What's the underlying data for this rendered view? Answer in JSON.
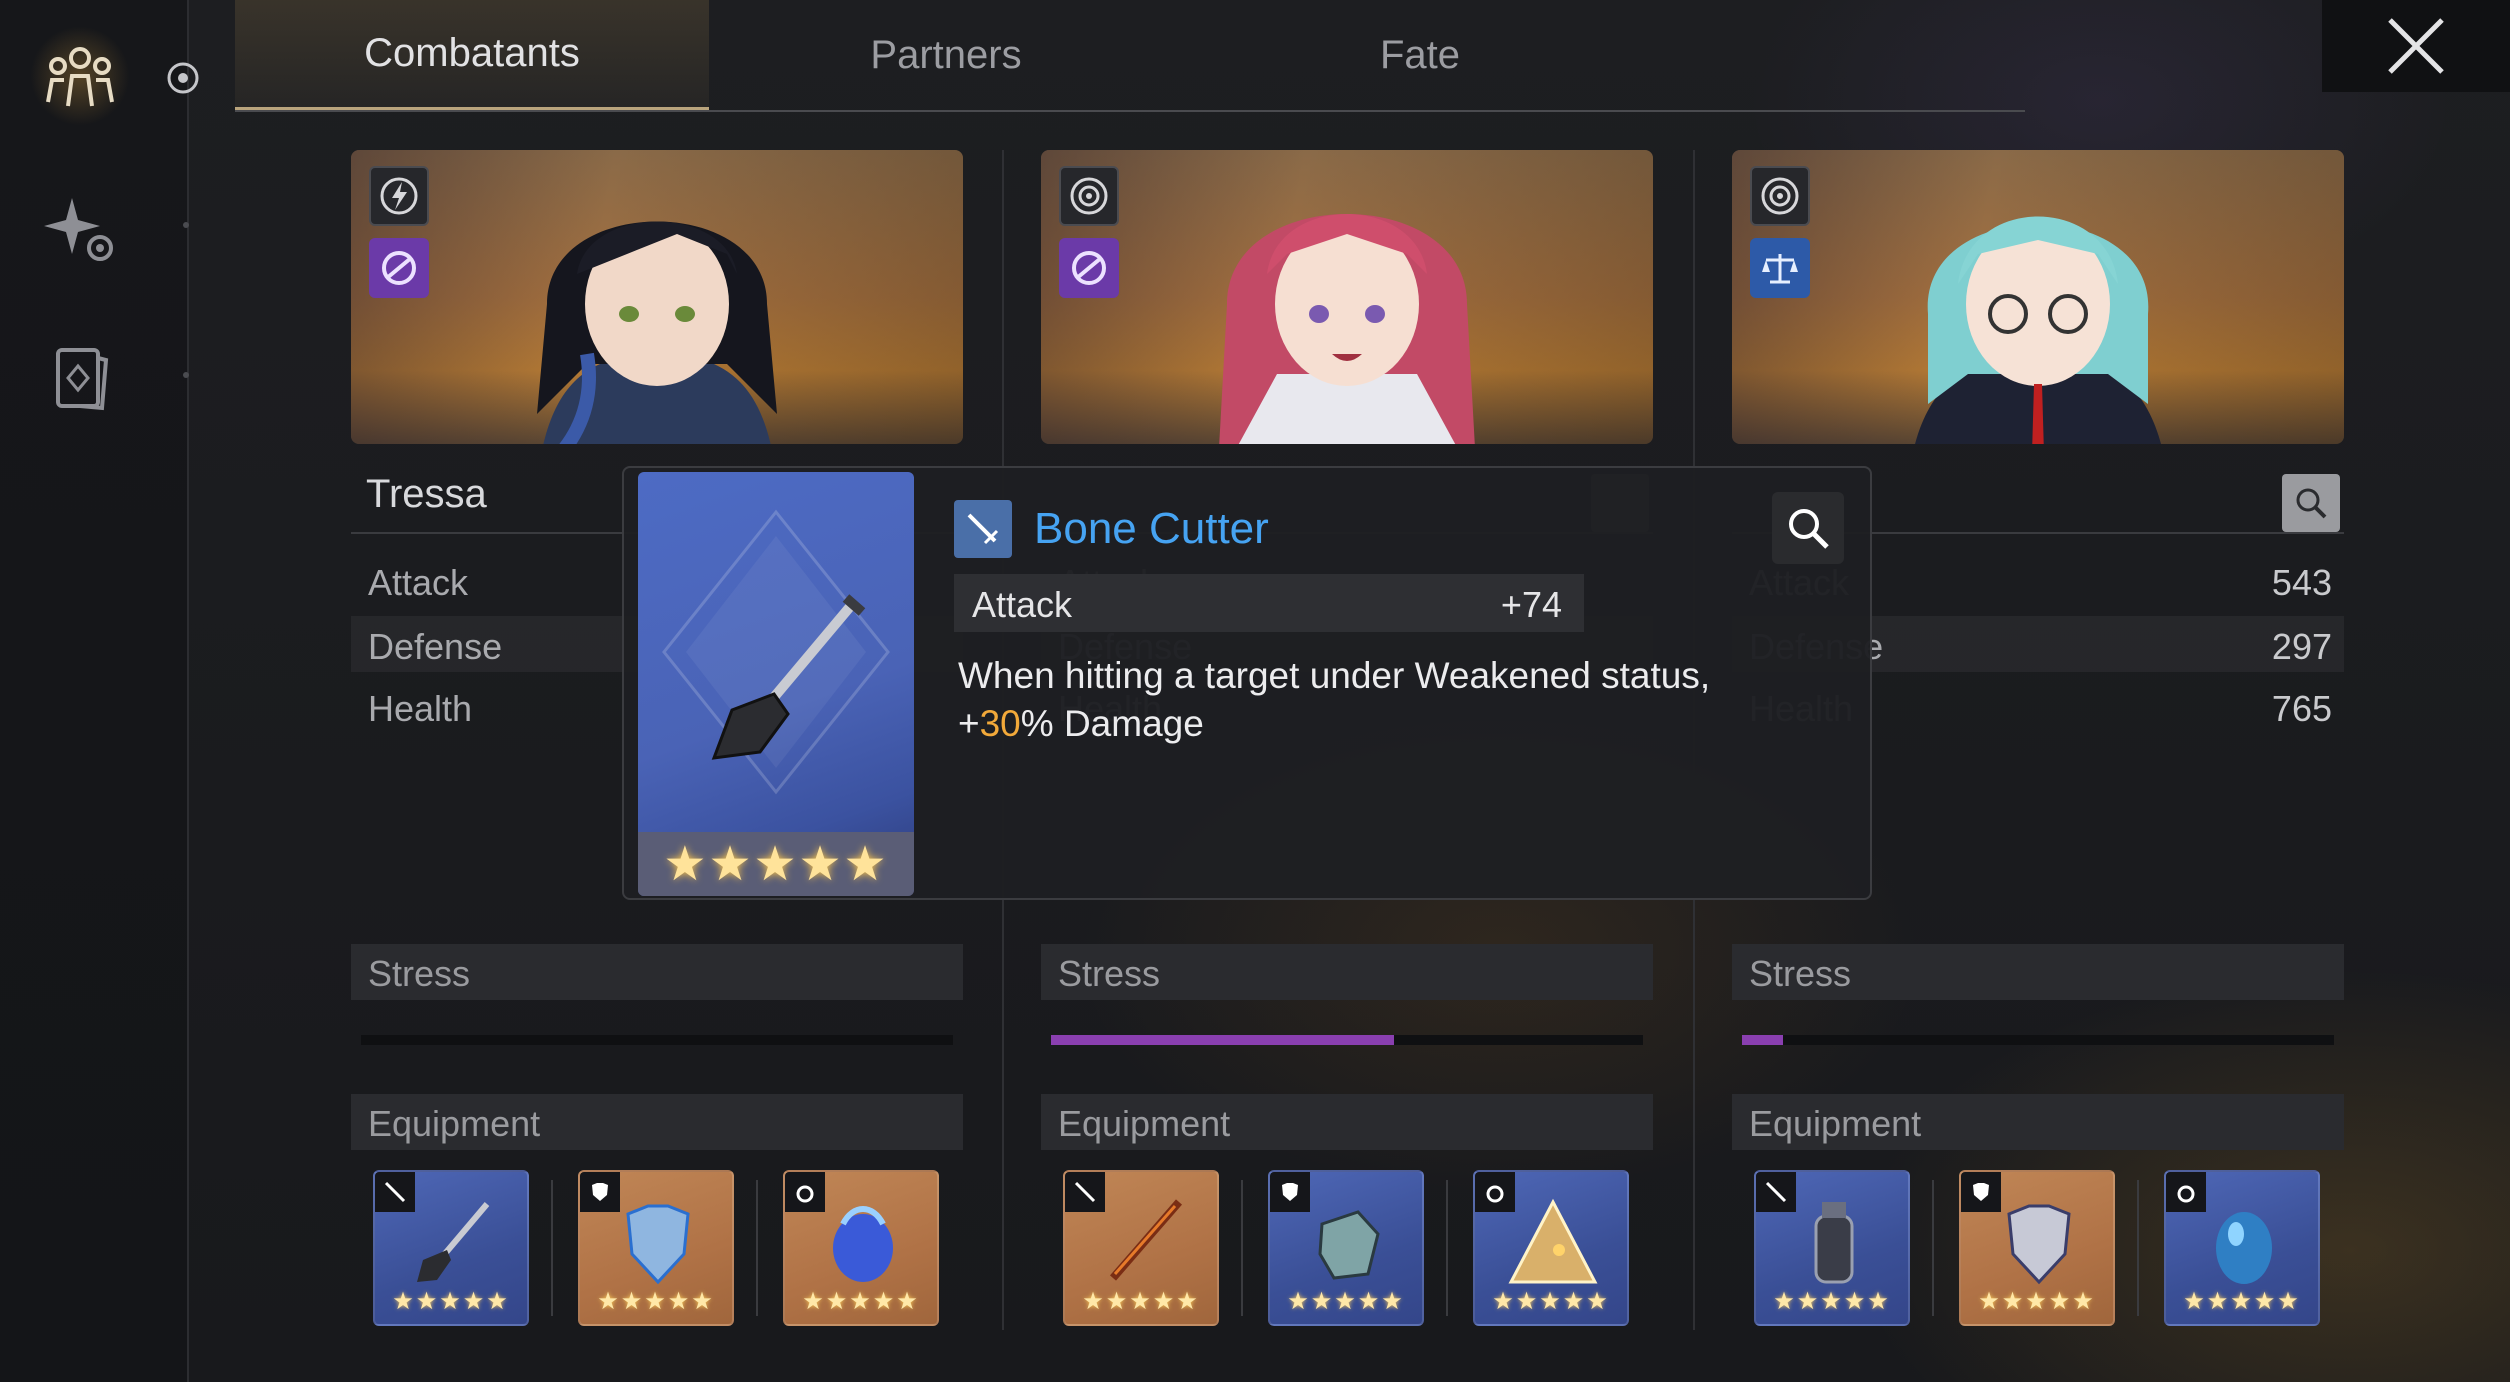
{
  "tabs": {
    "combatants": "Combatants",
    "partners": "Partners",
    "fate": "Fate"
  },
  "stat_labels": {
    "attack": "Attack",
    "defense": "Defense",
    "health": "Health"
  },
  "section_labels": {
    "stress": "Stress",
    "equipment": "Equipment"
  },
  "characters": [
    {
      "name": "Tressa",
      "attack": "",
      "defense": "",
      "health": "",
      "stress_fraction": 0.0
    },
    {
      "name": "",
      "attack": "",
      "defense": "",
      "health": "",
      "stress_fraction": 0.58
    },
    {
      "name": "",
      "attack": "543",
      "defense": "297",
      "health": "765",
      "stress_fraction": 0.07
    }
  ],
  "tooltip": {
    "item_name": "Bone Cutter",
    "stat_label": "Attack",
    "stat_value": "+74",
    "desc_line1": "When hitting a target under Weakened status,",
    "desc_prefix": "+",
    "desc_highlight": "30",
    "desc_suffix": "% Damage",
    "stars": "★★★★★",
    "rarity_stars": 5
  },
  "equip_stars": "★★★★★",
  "colors": {
    "accent_blue": "#46a3f2",
    "highlight_orange": "#f2a93a",
    "stress_purple": "#8a3fb0"
  }
}
